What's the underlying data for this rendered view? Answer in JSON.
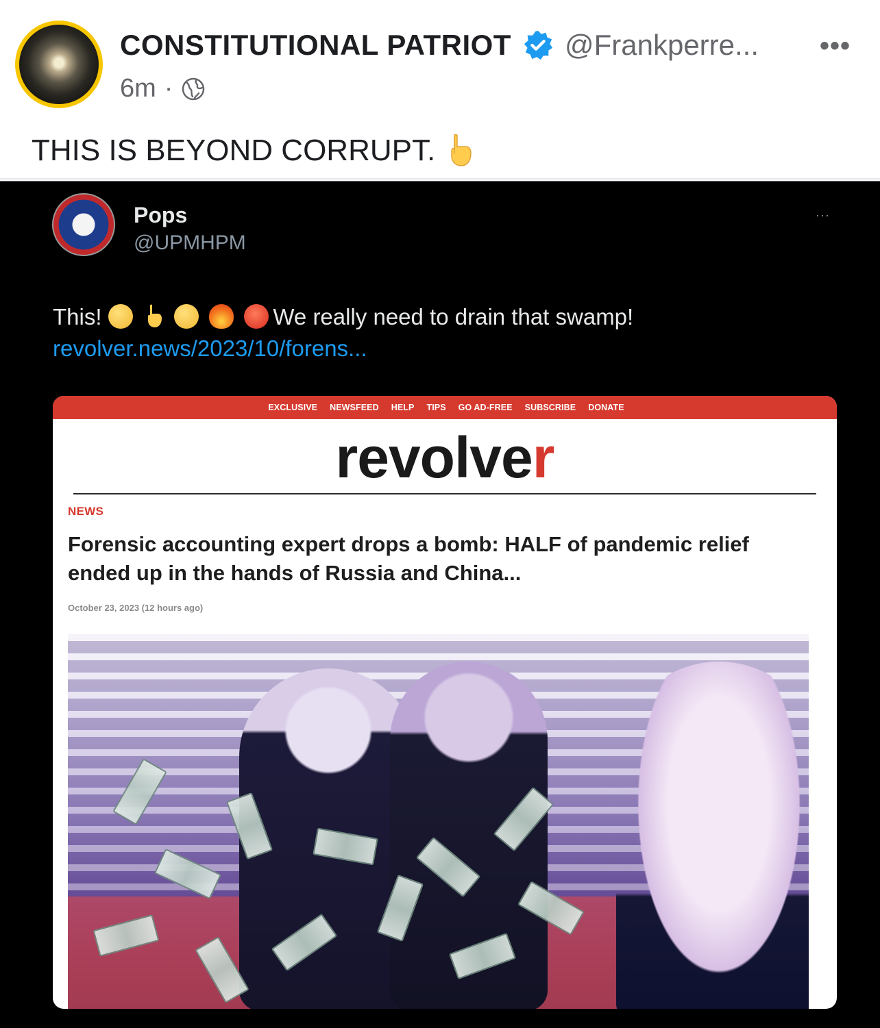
{
  "post": {
    "author": "CONSTITUTIONAL PATRIOT",
    "handle": "@Frankperre...",
    "time": "6m",
    "meta_separator": "·",
    "more": "•••",
    "text": "THIS IS BEYOND CORRUPT.",
    "icons": [
      "avatar",
      "verified-badge-icon",
      "globe-icon",
      "pointing-down-emoji-icon",
      "more-options-icon"
    ],
    "colors": {
      "avatar_ring": "#f7c600",
      "verified": "#1d9bf0"
    }
  },
  "embedded_tweet": {
    "name": "Pops",
    "handle": "@UPMHPM",
    "more": "···",
    "text_start": "This! ",
    "text_middle": "We really need to drain that swamp! ",
    "link": "revolver.news/2023/10/forens...",
    "emojis": [
      "facepalm-emoji-icon",
      "pointing-down-emoji-icon",
      "monocle-face-emoji-icon",
      "fire-emoji-icon",
      "cursing-face-emoji-icon"
    ],
    "colors": {
      "link": "#1d9bf0",
      "background": "#000000"
    }
  },
  "article": {
    "nav": [
      "EXCLUSIVE",
      "NEWSFEED",
      "HELP",
      "TIPS",
      "GO AD-FREE",
      "SUBSCRIBE",
      "DONATE"
    ],
    "brand_main": "revolve",
    "brand_last": "r",
    "section": "NEWS",
    "headline": "Forensic accounting expert drops a bomb: HALF of pandemic relief ended up in the hands of Russia and China...",
    "date": "October 23, 2023 (12 hours ago)",
    "colors": {
      "accent": "#d63a2f"
    }
  }
}
